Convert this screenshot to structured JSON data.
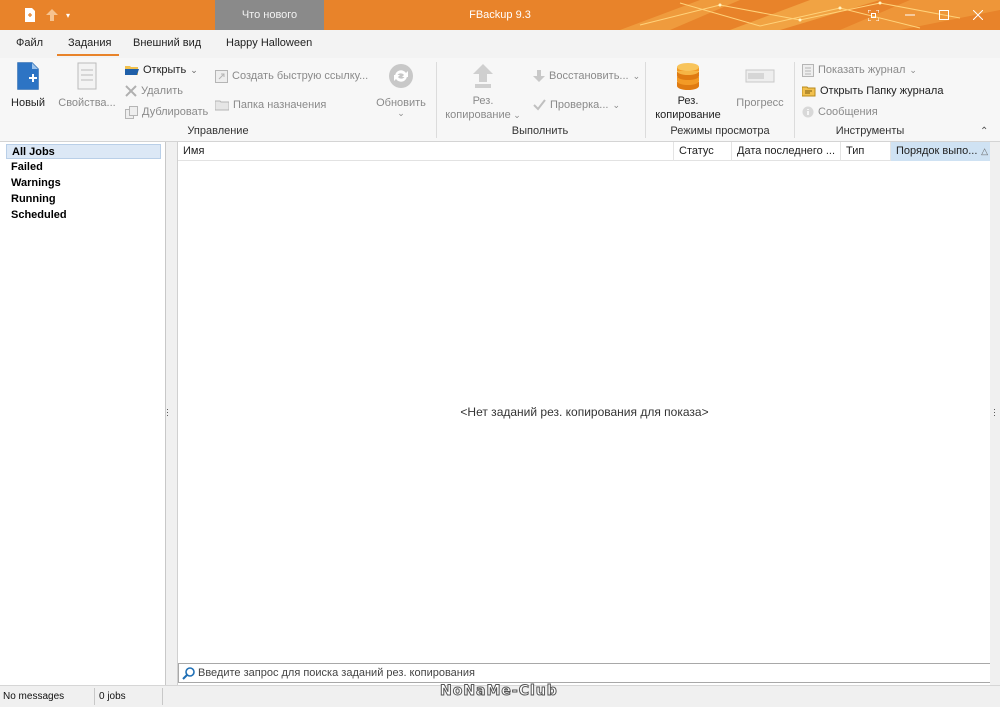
{
  "titlebar": {
    "app_title": "FBackup 9.3",
    "whats_new": "Что нового",
    "accent_color": "#e8832a"
  },
  "tabs": [
    {
      "label": "Файл"
    },
    {
      "label": "Задания",
      "active": true
    },
    {
      "label": "Внешний вид"
    },
    {
      "label": "Happy Halloween"
    }
  ],
  "ribbon": {
    "manage": {
      "label": "Управление",
      "new": "Новый",
      "properties": "Свойства...",
      "open": "Открыть",
      "delete": "Удалить",
      "duplicate": "Дублировать",
      "quick_link": "Создать быструю ссылку...",
      "dest_folder": "Папка назначения",
      "refresh": "Обновить"
    },
    "execute": {
      "label": "Выполнить",
      "backup_1": "Рез.",
      "backup_2": "копирование",
      "restore": "Восстановить...",
      "test": "Проверка..."
    },
    "view_modes": {
      "label": "Режимы просмотра",
      "backup_1": "Рез.",
      "backup_2": "копирование",
      "progress": "Прогресс"
    },
    "tools": {
      "label": "Инструменты",
      "show_log": "Показать журнал",
      "open_log_folder": "Открыть Папку журнала",
      "messages": "Сообщения"
    }
  },
  "sidebar": {
    "items": [
      {
        "label": "All Jobs",
        "selected": true
      },
      {
        "label": "Failed"
      },
      {
        "label": "Warnings"
      },
      {
        "label": "Running"
      },
      {
        "label": "Scheduled"
      }
    ]
  },
  "table": {
    "columns": [
      "Имя",
      "Статус",
      "Дата последнего ...",
      "Тип",
      "Порядок выпо..."
    ],
    "sorted_column": "Порядок выпо...",
    "empty_text": "<Нет заданий рез. копирования для показа>"
  },
  "search": {
    "placeholder": "Введите запрос для поиска заданий рез. копирования"
  },
  "statusbar": {
    "messages": "No messages",
    "jobs": "0 jobs"
  },
  "watermark": "NoNaMe-Club"
}
